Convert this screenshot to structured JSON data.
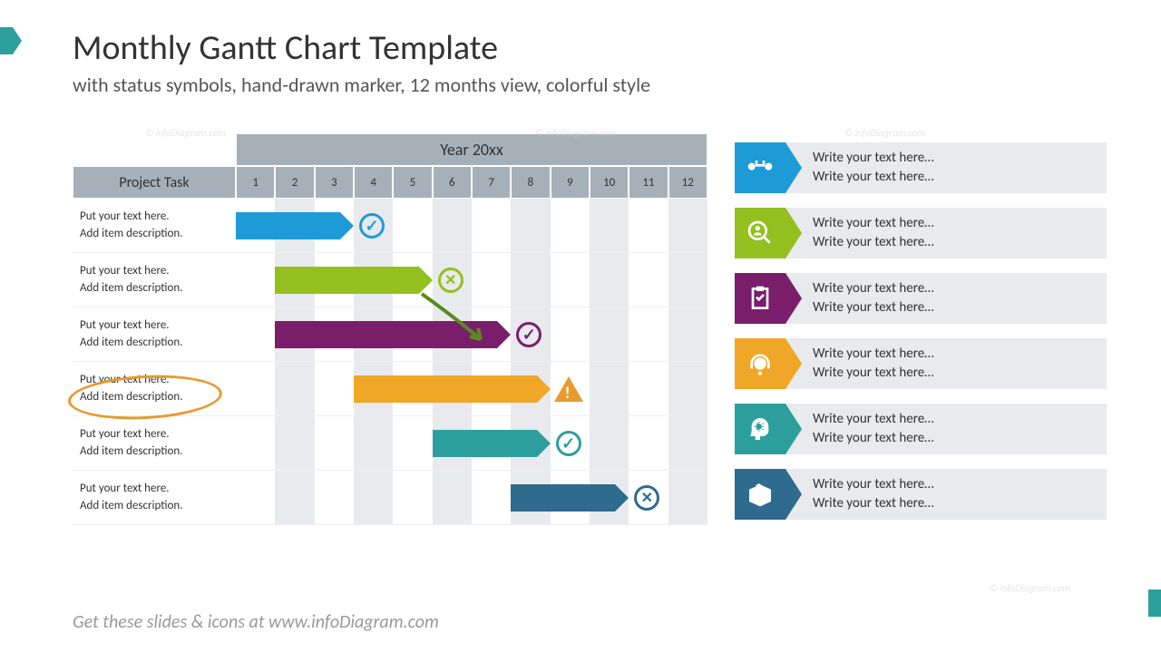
{
  "title": "Monthly Gantt Chart Template",
  "subtitle": "with status symbols, hand-drawn marker, 12 months view, colorful style",
  "footer": "Get these slides & icons at www.infoDiagram.com",
  "watermark": "© infoDiagram.com",
  "chart_data": {
    "type": "gantt",
    "year_label": "Year 20xx",
    "task_header": "Project Task",
    "months": [
      "1",
      "2",
      "3",
      "4",
      "5",
      "6",
      "7",
      "8",
      "9",
      "10",
      "11",
      "12"
    ],
    "tasks": [
      {
        "label": "Put your text here.",
        "desc": "Add item description.",
        "start": 1,
        "end": 3,
        "color": "#1e9bd7",
        "status": "check",
        "status_color": "#1e9bd7"
      },
      {
        "label": "Put your text here.",
        "desc": "Add item description.",
        "start": 2,
        "end": 5,
        "color": "#93c01f",
        "status": "x",
        "status_color": "#93c01f"
      },
      {
        "label": "Put your text here.",
        "desc": "Add item description.",
        "start": 2,
        "end": 7,
        "color": "#7a1e6c",
        "status": "check",
        "status_color": "#7a1e6c"
      },
      {
        "label": "Put your text here.",
        "desc": "Add item description.",
        "start": 4,
        "end": 8,
        "color": "#f0a626",
        "status": "warn",
        "status_color": "#e89a2e",
        "highlighted": true
      },
      {
        "label": "Put your text here.",
        "desc": "Add item description.",
        "start": 6,
        "end": 8,
        "color": "#2c9f9c",
        "status": "check",
        "status_color": "#2c9f9c"
      },
      {
        "label": "Put your text here.",
        "desc": "Add item description.",
        "start": 8,
        "end": 10,
        "color": "#2e6b8e",
        "status": "x",
        "status_color": "#2e6b8e"
      }
    ]
  },
  "legend": [
    {
      "color": "#1e9bd7",
      "icon": "binoculars",
      "line1": "Write your text here…",
      "line2": "Write your text here…"
    },
    {
      "color": "#93c01f",
      "icon": "magnify-user",
      "line1": "Write your text here…",
      "line2": "Write your text here…"
    },
    {
      "color": "#7a1e6c",
      "icon": "clipboard",
      "line1": "Write your text here…",
      "line2": "Write your text here…"
    },
    {
      "color": "#f0a626",
      "icon": "headset",
      "line1": "Write your text here…",
      "line2": "Write your text here…"
    },
    {
      "color": "#2c9f9c",
      "icon": "head-gear",
      "line1": "Write your text here…",
      "line2": "Write your text here…"
    },
    {
      "color": "#2e6b8e",
      "icon": "box",
      "line1": "Write your text here…",
      "line2": "Write your text here…"
    }
  ]
}
